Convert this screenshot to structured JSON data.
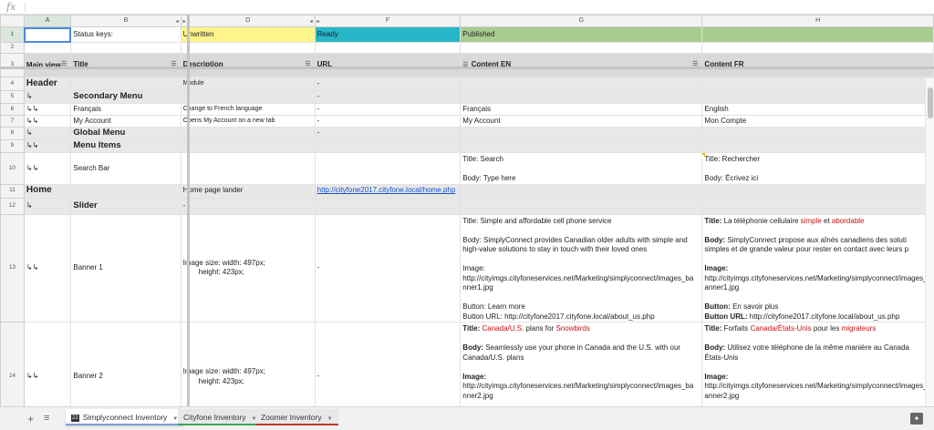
{
  "formula_bar": {
    "fx_label": "fx"
  },
  "columns": [
    {
      "id": "A",
      "selected": true
    },
    {
      "id": "B"
    },
    {
      "id": "D"
    },
    {
      "id": "F"
    },
    {
      "id": "G"
    },
    {
      "id": "H"
    }
  ],
  "status_keys": {
    "label": "Status keys:",
    "unwritten": "Unwritten",
    "ready": "Ready",
    "published": "Published",
    "colors": {
      "unwritten": "#fff48c",
      "ready": "#27b6c7",
      "published": "#a8cc8f"
    }
  },
  "headers": {
    "main_view": "Main view",
    "title": "Title",
    "description": "Description",
    "url": "URL",
    "content_en": "Content EN",
    "content_fr": "Content FR"
  },
  "rows": {
    "r1": {
      "num": "1"
    },
    "r2": {
      "num": "2"
    },
    "r3": {
      "num": "3"
    },
    "r4": {
      "num": "4",
      "a": "Header",
      "d": "Module",
      "f": "-"
    },
    "r5": {
      "num": "5",
      "a": "↳",
      "b": "Secondary Menu",
      "f": "-"
    },
    "r6": {
      "num": "6",
      "a": "↳↳",
      "b": "Français",
      "d": "Change to French language",
      "f": "-",
      "g": "Français",
      "h": "English"
    },
    "r7": {
      "num": "7",
      "a": "↳↳",
      "b": "My Account",
      "d": "Opens My Account on a new tab",
      "f": "-",
      "g": "My Account",
      "h": "Mon Compte"
    },
    "r8": {
      "num": "8",
      "a": "↳",
      "b": "Global Menu",
      "f": "-"
    },
    "r9": {
      "num": "9",
      "a": "↳↳",
      "b": "Menu Items"
    },
    "r10": {
      "num": "10",
      "a": "↳↳",
      "b": "Search Bar",
      "g1": "Title: Search",
      "g2": "Body: Type here",
      "h1": "Title: Rechercher",
      "h2": "Body: Écrivez ici"
    },
    "r11": {
      "num": "11",
      "a": "Home",
      "d": "Home page lander",
      "f": "http://cityfone2017.cityfone.local/home.php"
    },
    "r12": {
      "num": "12",
      "a": "↳",
      "b": "Slider",
      "d": "-"
    },
    "r13": {
      "num": "13",
      "a": "↳↳",
      "b": "Banner 1",
      "d1": "Image size: width: 497px;",
      "d2": "height: 423px;",
      "f": "-",
      "g_title": "Title: Simple and affordable cell phone service",
      "g_body1": "Body: SimplyConnect provides Canadian older adults with simple and",
      "g_body2": "high-value solutions to stay in touch with their loved ones",
      "g_image": "Image:",
      "g_img1": "http://cityimgs.cityfoneservices.net/Marketing/simplyconnect/images_ba",
      "g_img2": "nner1.jpg",
      "g_btn": "Button: Learn more",
      "g_btnurl": "Button URL: http://cityfone2017.cityfone.local/about_us.php",
      "h_title_lbl": "Title:",
      "h_title_a": " La téléphonie cellulaire ",
      "h_title_b": "simple",
      "h_title_c": " et ",
      "h_title_d": "abordable",
      "h_body_lbl": "Body:",
      "h_body1": " SimplyConnect propose aux aînés canadiens des soluti",
      "h_body2": "simples et de grande valeur pour rester en contact avec leurs p",
      "h_image": "Image:",
      "h_img1": "http://cityimgs.cityfoneservices.net/Marketing/simplyconnect/images_b",
      "h_img2": "anner1.jpg",
      "h_btn_lbl": "Button:",
      "h_btn": " En savoir plus",
      "h_btnurl_lbl": "Button URL:",
      "h_btnurl": " http://cityfone2017.cityfone.local/about_us.php"
    },
    "r14": {
      "num": "14",
      "a": "↳↳",
      "b": "Banner 2",
      "d1": "Image size: width: 497px;",
      "d2": "height: 423px;",
      "f": "-",
      "g_title_lbl": "Title:",
      "g_title_a": "Canada/U.S.",
      "g_title_b": " plans for ",
      "g_title_c": "Snowbirds",
      "g_body_lbl": "Body:",
      "g_body1": " Seamlessly use your phone in Canada and the U.S. with our",
      "g_body2": "Canada/U.S. plans",
      "g_image": "Image:",
      "g_img1": "http://cityimgs.cityfoneservices.net/Marketing/simplyconnect/images_ba",
      "g_img2": "nner2.jpg",
      "h_title_lbl": "Title:",
      "h_title_a": " Forfaits ",
      "h_title_b": "Canada/États-Unis",
      "h_title_c": " pour les ",
      "h_title_d": "migrateurs",
      "h_body_lbl": "Body:",
      "h_body1": " Utilisez votre téléphone de la même manière au Canada",
      "h_body2": "États-Unis",
      "h_image": "Image:",
      "h_img1": "http://cityimgs.cityfoneservices.net/Marketing/simplyconnect/images_b",
      "h_img2": "anner2.jpg"
    }
  },
  "tabs": [
    {
      "label": "Simplyconnect Inventory",
      "badge": "22",
      "active": true,
      "color": "#7b9fd5"
    },
    {
      "label": "Cityfone Inventory",
      "active": false,
      "color": "#3aa757"
    },
    {
      "label": "Zoomer Inventory",
      "active": false,
      "color": "#c0392b"
    }
  ],
  "icons": {
    "add_sheet": "plus-icon",
    "all_sheets": "menu-icon",
    "explore": "explore-icon"
  }
}
